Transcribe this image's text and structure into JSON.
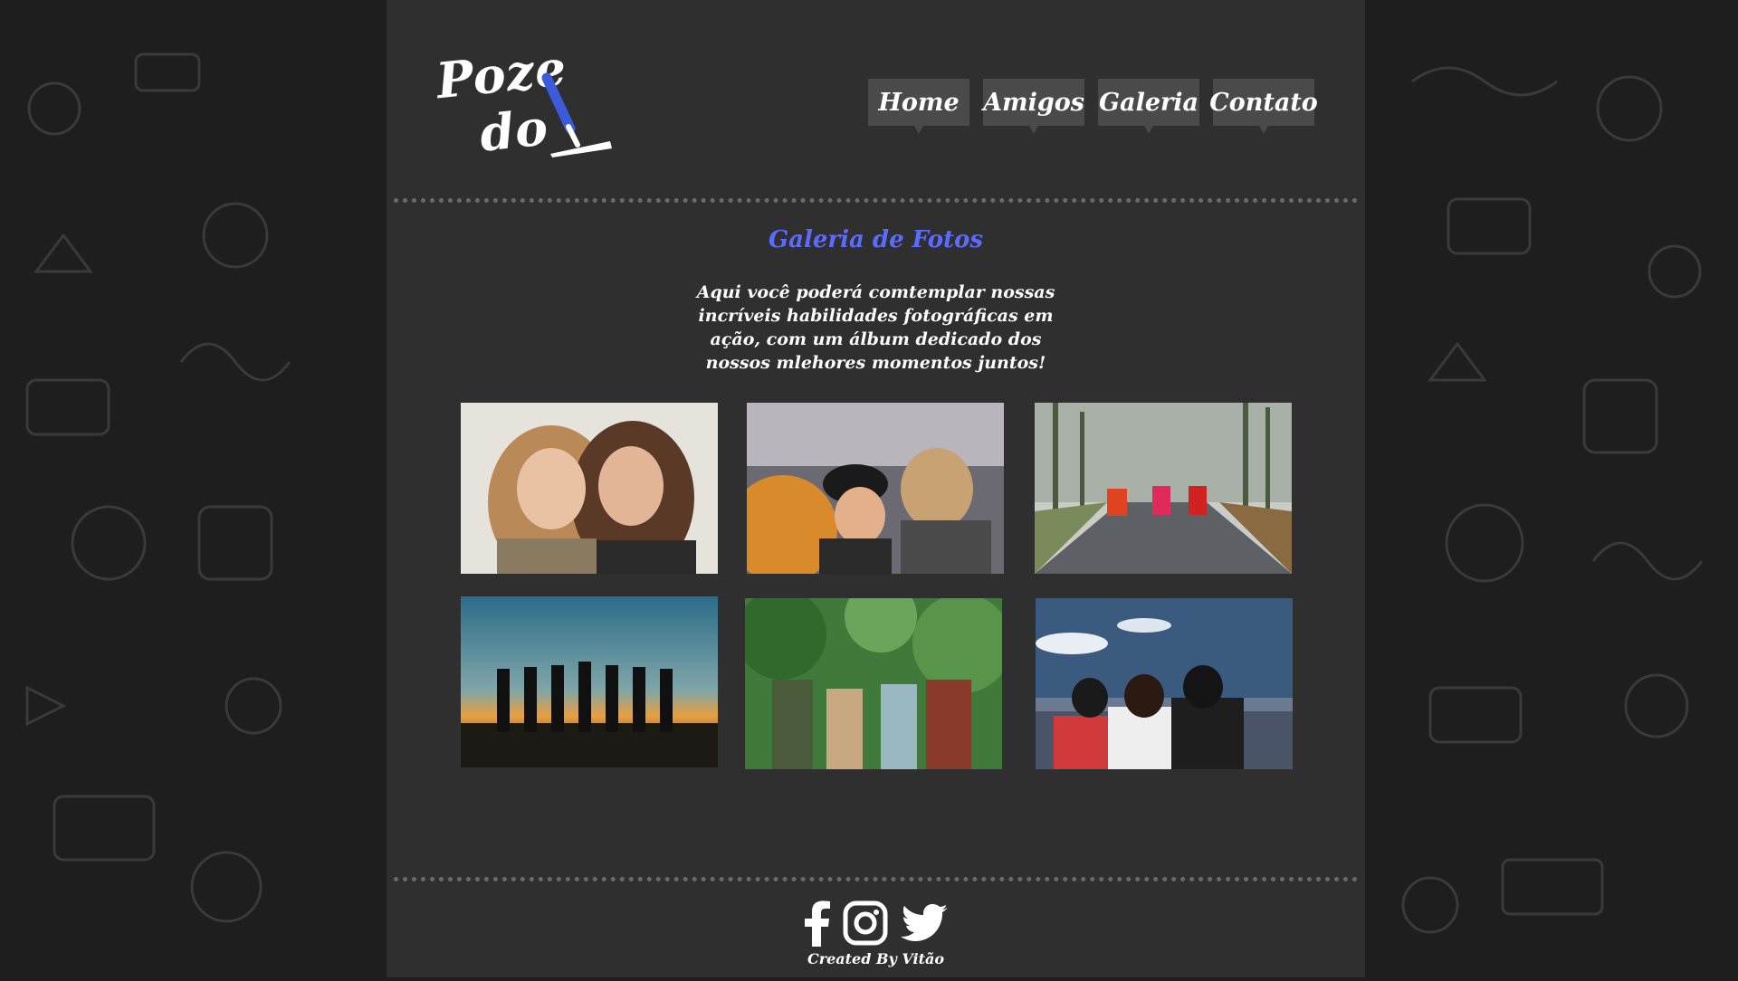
{
  "logo": {
    "line1": "Poze",
    "line2": "do"
  },
  "nav": {
    "items": [
      {
        "label": "Home"
      },
      {
        "label": "Amigos"
      },
      {
        "label": "Galeria"
      },
      {
        "label": "Contato"
      }
    ]
  },
  "gallery": {
    "title": "Galeria de Fotos",
    "intro": "Aqui você poderá comtemplar nossas incríveis habilidades fotográficas em ação, com um álbum dedicado dos nossos mlehores momentos juntos!"
  },
  "footer": {
    "social_icons": [
      "facebook-icon",
      "instagram-icon",
      "twitter-icon"
    ],
    "credit": "Created By Vitão"
  },
  "colors": {
    "page_bg": "#2f2f2f",
    "outer_bg": "#1e1e1e",
    "accent": "#5b6bff",
    "nav_bg": "#4a4a4a"
  }
}
